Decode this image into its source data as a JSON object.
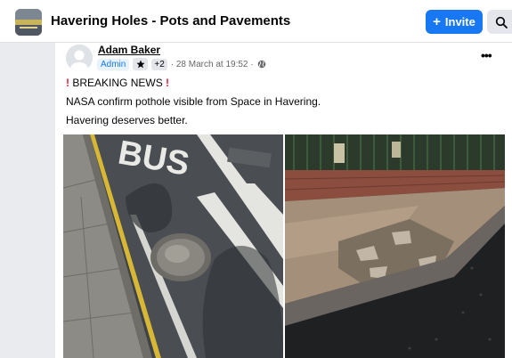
{
  "header": {
    "group_title": "Havering Holes - Pots and Pavements",
    "invite_label": "Invite"
  },
  "post": {
    "author": "Adam Baker",
    "badge_admin": "Admin",
    "badge_extra": "+2",
    "timestamp": "· 28 March at 19:52 ·",
    "breaking": "BREAKING NEWS",
    "line1": "NASA confirm pothole visible from Space in Havering.",
    "line2": "Havering deserves better.",
    "road_marking": "BUS"
  },
  "icons": {
    "invite": "plus-icon",
    "search": "search-icon",
    "audience": "globe-icon",
    "star": "star-icon",
    "more": "more-icon",
    "alert": "exclamation-icon"
  },
  "colors": {
    "accent": "#1877f2",
    "alert": "#e41e3f",
    "text_secondary": "#65676b"
  }
}
